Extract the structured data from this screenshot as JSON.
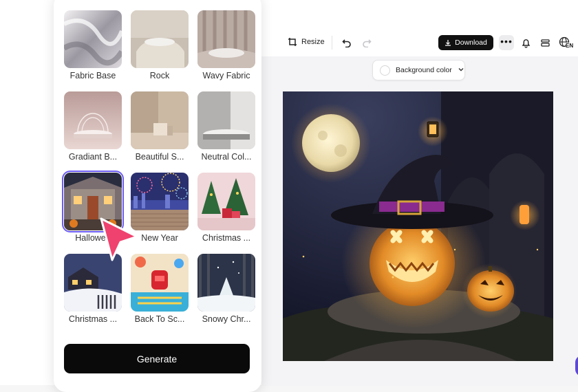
{
  "toolbar": {
    "resize_label": "Resize",
    "download_label": "Download",
    "language_badge": "EN"
  },
  "background": {
    "label": "Background color"
  },
  "templates": [
    {
      "label": "Fabric Base"
    },
    {
      "label": "Rock"
    },
    {
      "label": "Wavy Fabric"
    },
    {
      "label": "Gradiant B..."
    },
    {
      "label": "Beautiful S..."
    },
    {
      "label": "Neutral Col..."
    },
    {
      "label": "Hallowee"
    },
    {
      "label": "New Year"
    },
    {
      "label": "Christmas ..."
    },
    {
      "label": "Christmas ..."
    },
    {
      "label": "Back To Sc..."
    },
    {
      "label": "Snowy Chr..."
    }
  ],
  "generate": {
    "label": "Generate"
  },
  "colors": {
    "accent": "#6b5cf2",
    "cursor": "#f0426e",
    "button": "#0a0a0a"
  }
}
